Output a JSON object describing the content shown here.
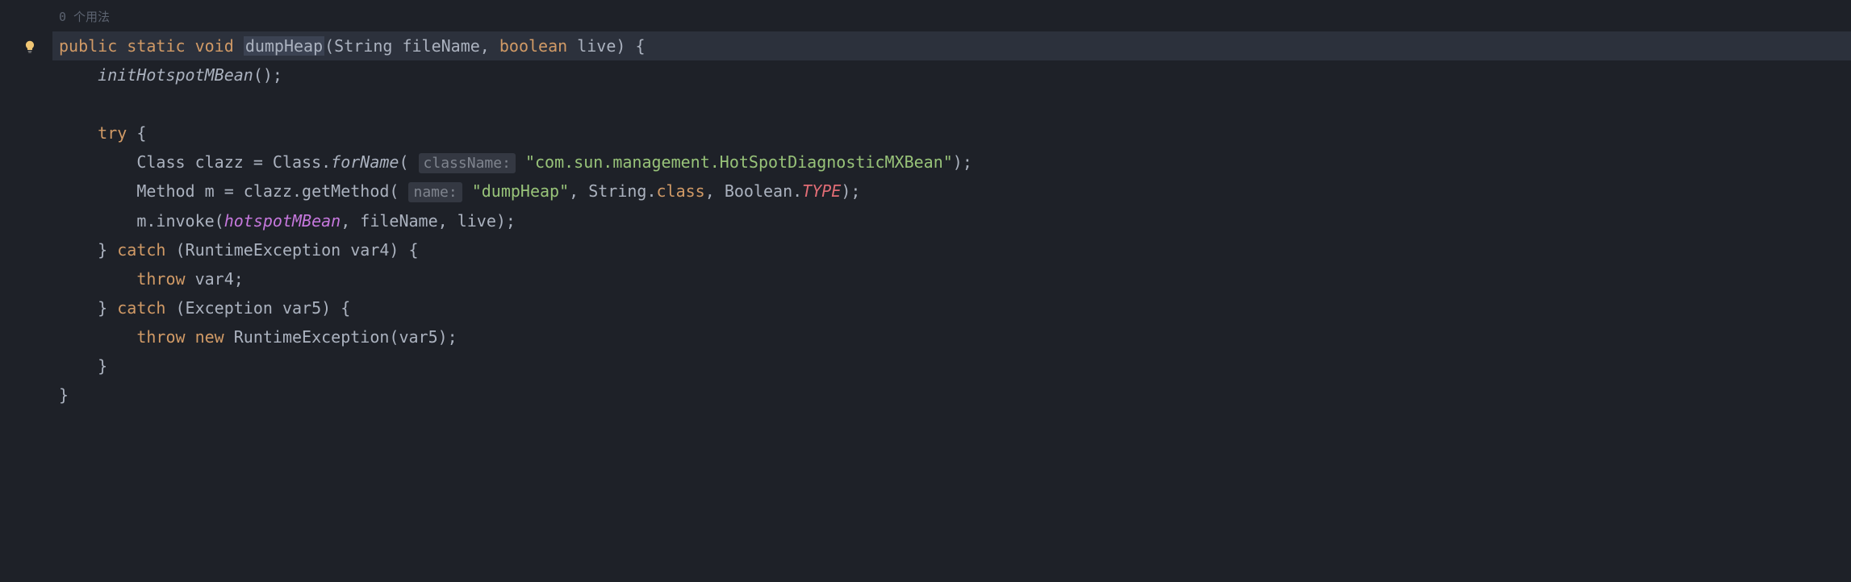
{
  "usageHint": "0 个用法",
  "code": {
    "line1": {
      "public": "public",
      "static": "static",
      "void": "void",
      "methodName": "dumpHeap",
      "paramOpen": "(String fileName, ",
      "boolean": "boolean",
      "paramClose": " live) {"
    },
    "line2": {
      "indent": "    ",
      "call": "initHotspotMBean",
      "suffix": "();"
    },
    "line3": "",
    "line4": {
      "indent": "    ",
      "try": "try",
      "brace": " {"
    },
    "line5": {
      "indent": "        Class clazz = Class.",
      "forName": "forName",
      "open": "( ",
      "hint": "className:",
      "space": " ",
      "string": "\"com.sun.management.HotSpotDiagnosticMXBean\"",
      "close": ");"
    },
    "line6": {
      "indent": "        Method m = clazz.getMethod( ",
      "hint": "name:",
      "space": " ",
      "string": "\"dumpHeap\"",
      "mid": ", String.",
      "class1": "class",
      "mid2": ", Boolean.",
      "type": "TYPE",
      "close": ");"
    },
    "line7": {
      "indent": "        m.invoke(",
      "field": "hotspotMBean",
      "close": ", fileName, live);"
    },
    "line8": {
      "indent": "    } ",
      "catch": "catch",
      "params": " (RuntimeException var4) {"
    },
    "line9": {
      "indent": "        ",
      "throw": "throw",
      "rest": " var4;"
    },
    "line10": {
      "indent": "    } ",
      "catch": "catch",
      "params": " (Exception var5) {"
    },
    "line11": {
      "indent": "        ",
      "throw": "throw",
      "space": " ",
      "new": "new",
      "rest": " RuntimeException(var5);"
    },
    "line12": "    }",
    "line13": "}"
  }
}
